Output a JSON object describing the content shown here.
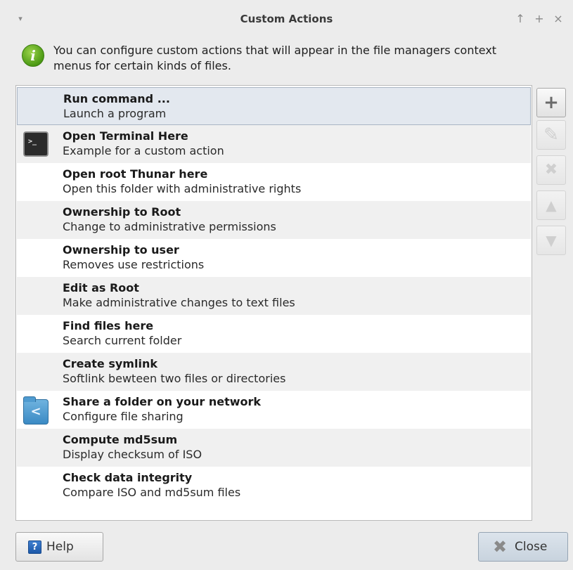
{
  "window": {
    "title": "Custom Actions",
    "menu_glyph": "▾",
    "controls": {
      "up": "↑",
      "maximize": "+",
      "close": "×"
    }
  },
  "info": {
    "icon": "info-icon",
    "icon_glyph": "i",
    "text": "You can configure custom actions that will appear in the file managers context menus for certain kinds of files."
  },
  "actions": [
    {
      "name": "Run command ...",
      "desc": "Launch a program",
      "icon": "",
      "selected": true
    },
    {
      "name": "Open Terminal Here",
      "desc": "Example for a custom action",
      "icon": "terminal-icon"
    },
    {
      "name": "Open root Thunar here",
      "desc": "Open this folder with administrative rights",
      "icon": ""
    },
    {
      "name": "Ownership to Root",
      "desc": "Change to administrative permissions",
      "icon": ""
    },
    {
      "name": "Ownership to user",
      "desc": "Removes use restrictions",
      "icon": ""
    },
    {
      "name": "Edit as Root",
      "desc": "Make administrative changes to text files",
      "icon": ""
    },
    {
      "name": "Find files here",
      "desc": "Search current folder",
      "icon": ""
    },
    {
      "name": "Create symlink",
      "desc": "Softlink bewteen two files or directories",
      "icon": ""
    },
    {
      "name": "Share a folder on your network",
      "desc": "Configure file sharing",
      "icon": "folder-share-icon"
    },
    {
      "name": "Compute md5sum",
      "desc": "Display checksum of ISO",
      "icon": ""
    },
    {
      "name": "Check data integrity",
      "desc": "Compare ISO and md5sum files",
      "icon": ""
    }
  ],
  "icons": {
    "terminal_glyph": ">_",
    "share_glyph": "<"
  },
  "side_buttons": [
    {
      "icon": "add-icon",
      "glyph": "+",
      "enabled": true
    },
    {
      "icon": "edit-icon",
      "glyph": "✎",
      "enabled": false
    },
    {
      "icon": "delete-icon",
      "glyph": "✖",
      "enabled": false
    },
    {
      "icon": "move-up-icon",
      "glyph": "▲",
      "enabled": false
    },
    {
      "icon": "move-down-icon",
      "glyph": "▼",
      "enabled": false
    }
  ],
  "buttons": {
    "help_label": "Help",
    "help_glyph": "?",
    "close_label": "Close",
    "close_glyph": "✖"
  },
  "colors": {
    "selected_row": "#e3e8ef",
    "alt_row": "#f0f0f0"
  }
}
